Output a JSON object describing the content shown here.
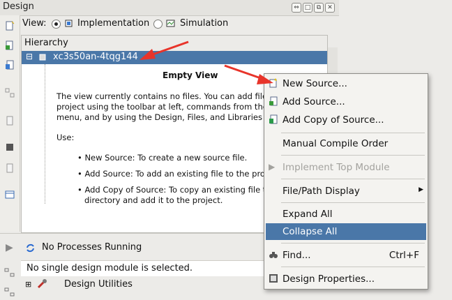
{
  "window": {
    "title": "Design"
  },
  "view": {
    "label": "View:",
    "opt1": "Implementation",
    "opt2": "Simulation",
    "selected": "Implementation"
  },
  "hierarchy": {
    "header": "Hierarchy",
    "device": "xc3s50an-4tqg144"
  },
  "emptyview": {
    "title": "Empty View",
    "para1": "The view currently contains no files. You can add file",
    "para2": "project using the toolbar at left, commands from the",
    "para3": "menu, and by using the Design, Files, and Libraries",
    "use": "Use:",
    "b1": "• New Source: To create a new source file.",
    "b2": "• Add Source: To add an existing file to the pro",
    "b3": "• Add Copy of Source: To copy an existing file t",
    "b3b": "directory and add it to the project."
  },
  "processes": {
    "status": "No Processes Running",
    "message": "No single design module is selected.",
    "item": "Design Utilities"
  },
  "menu": {
    "items": [
      {
        "label": "New Source..."
      },
      {
        "label": "Add Source..."
      },
      {
        "label": "Add Copy of Source..."
      },
      {
        "label": "Manual Compile Order"
      },
      {
        "label": "Implement Top Module"
      },
      {
        "label": "File/Path Display"
      },
      {
        "label": "Expand All"
      },
      {
        "label": "Collapse All"
      },
      {
        "label": "Find...",
        "shortcut": "Ctrl+F"
      },
      {
        "label": "Design Properties..."
      }
    ]
  },
  "colors": {
    "selection": "#4a77a8",
    "arrow": "#e8342a"
  }
}
